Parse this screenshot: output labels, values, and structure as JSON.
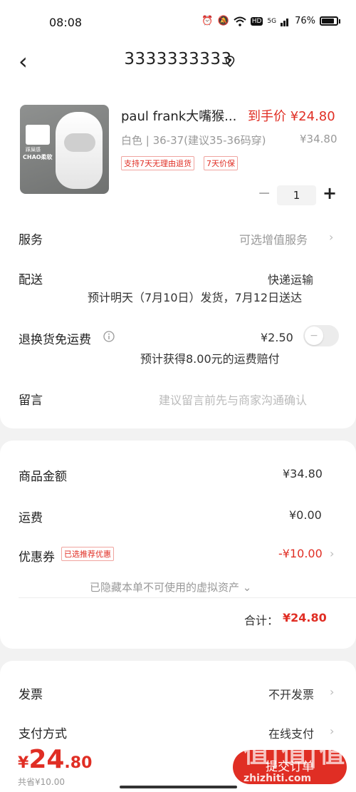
{
  "status_bar": {
    "time": "08:08",
    "network": "5G",
    "battery": "76%"
  },
  "header": {
    "title": "3333333333"
  },
  "product": {
    "name": "paul frank大嘴猴...",
    "price_label": "到手价 ¥24.80",
    "spec": "白色 | 36-37(建议35-36码穿)",
    "original_price": "¥34.80",
    "tags": [
      "支持7天无理由退货",
      "7天价保"
    ],
    "image_text": [
      "踩屎感",
      "CHAO柔软"
    ],
    "quantity": "1"
  },
  "service": {
    "label": "服务",
    "value": "可选增值服务"
  },
  "delivery": {
    "label": "配送",
    "method": "快递运输",
    "estimate": "预计明天（7月10日）发货，7月12日送达"
  },
  "return_shipping": {
    "label": "退换货免运费",
    "price": "¥2.50",
    "note": "预计获得8.00元的运费赔付",
    "enabled": false
  },
  "message": {
    "label": "留言",
    "placeholder": "建议留言前先与商家沟通确认"
  },
  "summary": {
    "goods_label": "商品金额",
    "goods_value": "¥34.80",
    "shipping_label": "运费",
    "shipping_value": "¥0.00",
    "coupon_label": "优惠券",
    "coupon_tag": "已选推荐优惠",
    "coupon_value": "-¥10.00",
    "hidden_assets": "已隐藏本单不可使用的虚拟资产",
    "total_label": "合计：",
    "total_value": "¥24.80"
  },
  "invoice": {
    "label": "发票",
    "value": "不开发票"
  },
  "payment": {
    "label": "支付方式",
    "value": "在线支付"
  },
  "bottom": {
    "currency": "¥",
    "price_int": "24",
    "price_dec": ".80",
    "saved": "共省¥10.00",
    "submit_label": "提交订单"
  },
  "watermark": {
    "main": "值|值|值",
    "sub": "zhizhiti.com"
  },
  "colors": {
    "accent": "#e02e24",
    "background": "#f2f2f2"
  }
}
